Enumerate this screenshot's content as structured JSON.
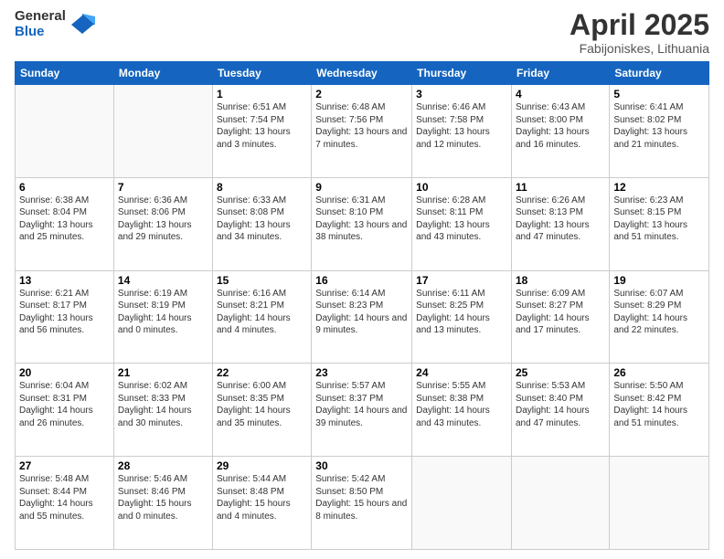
{
  "header": {
    "logo_general": "General",
    "logo_blue": "Blue",
    "title": "April 2025",
    "location": "Fabijoniskes, Lithuania"
  },
  "weekdays": [
    "Sunday",
    "Monday",
    "Tuesday",
    "Wednesday",
    "Thursday",
    "Friday",
    "Saturday"
  ],
  "weeks": [
    [
      {
        "day": "",
        "info": ""
      },
      {
        "day": "",
        "info": ""
      },
      {
        "day": "1",
        "info": "Sunrise: 6:51 AM\nSunset: 7:54 PM\nDaylight: 13 hours and 3 minutes."
      },
      {
        "day": "2",
        "info": "Sunrise: 6:48 AM\nSunset: 7:56 PM\nDaylight: 13 hours and 7 minutes."
      },
      {
        "day": "3",
        "info": "Sunrise: 6:46 AM\nSunset: 7:58 PM\nDaylight: 13 hours and 12 minutes."
      },
      {
        "day": "4",
        "info": "Sunrise: 6:43 AM\nSunset: 8:00 PM\nDaylight: 13 hours and 16 minutes."
      },
      {
        "day": "5",
        "info": "Sunrise: 6:41 AM\nSunset: 8:02 PM\nDaylight: 13 hours and 21 minutes."
      }
    ],
    [
      {
        "day": "6",
        "info": "Sunrise: 6:38 AM\nSunset: 8:04 PM\nDaylight: 13 hours and 25 minutes."
      },
      {
        "day": "7",
        "info": "Sunrise: 6:36 AM\nSunset: 8:06 PM\nDaylight: 13 hours and 29 minutes."
      },
      {
        "day": "8",
        "info": "Sunrise: 6:33 AM\nSunset: 8:08 PM\nDaylight: 13 hours and 34 minutes."
      },
      {
        "day": "9",
        "info": "Sunrise: 6:31 AM\nSunset: 8:10 PM\nDaylight: 13 hours and 38 minutes."
      },
      {
        "day": "10",
        "info": "Sunrise: 6:28 AM\nSunset: 8:11 PM\nDaylight: 13 hours and 43 minutes."
      },
      {
        "day": "11",
        "info": "Sunrise: 6:26 AM\nSunset: 8:13 PM\nDaylight: 13 hours and 47 minutes."
      },
      {
        "day": "12",
        "info": "Sunrise: 6:23 AM\nSunset: 8:15 PM\nDaylight: 13 hours and 51 minutes."
      }
    ],
    [
      {
        "day": "13",
        "info": "Sunrise: 6:21 AM\nSunset: 8:17 PM\nDaylight: 13 hours and 56 minutes."
      },
      {
        "day": "14",
        "info": "Sunrise: 6:19 AM\nSunset: 8:19 PM\nDaylight: 14 hours and 0 minutes."
      },
      {
        "day": "15",
        "info": "Sunrise: 6:16 AM\nSunset: 8:21 PM\nDaylight: 14 hours and 4 minutes."
      },
      {
        "day": "16",
        "info": "Sunrise: 6:14 AM\nSunset: 8:23 PM\nDaylight: 14 hours and 9 minutes."
      },
      {
        "day": "17",
        "info": "Sunrise: 6:11 AM\nSunset: 8:25 PM\nDaylight: 14 hours and 13 minutes."
      },
      {
        "day": "18",
        "info": "Sunrise: 6:09 AM\nSunset: 8:27 PM\nDaylight: 14 hours and 17 minutes."
      },
      {
        "day": "19",
        "info": "Sunrise: 6:07 AM\nSunset: 8:29 PM\nDaylight: 14 hours and 22 minutes."
      }
    ],
    [
      {
        "day": "20",
        "info": "Sunrise: 6:04 AM\nSunset: 8:31 PM\nDaylight: 14 hours and 26 minutes."
      },
      {
        "day": "21",
        "info": "Sunrise: 6:02 AM\nSunset: 8:33 PM\nDaylight: 14 hours and 30 minutes."
      },
      {
        "day": "22",
        "info": "Sunrise: 6:00 AM\nSunset: 8:35 PM\nDaylight: 14 hours and 35 minutes."
      },
      {
        "day": "23",
        "info": "Sunrise: 5:57 AM\nSunset: 8:37 PM\nDaylight: 14 hours and 39 minutes."
      },
      {
        "day": "24",
        "info": "Sunrise: 5:55 AM\nSunset: 8:38 PM\nDaylight: 14 hours and 43 minutes."
      },
      {
        "day": "25",
        "info": "Sunrise: 5:53 AM\nSunset: 8:40 PM\nDaylight: 14 hours and 47 minutes."
      },
      {
        "day": "26",
        "info": "Sunrise: 5:50 AM\nSunset: 8:42 PM\nDaylight: 14 hours and 51 minutes."
      }
    ],
    [
      {
        "day": "27",
        "info": "Sunrise: 5:48 AM\nSunset: 8:44 PM\nDaylight: 14 hours and 55 minutes."
      },
      {
        "day": "28",
        "info": "Sunrise: 5:46 AM\nSunset: 8:46 PM\nDaylight: 15 hours and 0 minutes."
      },
      {
        "day": "29",
        "info": "Sunrise: 5:44 AM\nSunset: 8:48 PM\nDaylight: 15 hours and 4 minutes."
      },
      {
        "day": "30",
        "info": "Sunrise: 5:42 AM\nSunset: 8:50 PM\nDaylight: 15 hours and 8 minutes."
      },
      {
        "day": "",
        "info": ""
      },
      {
        "day": "",
        "info": ""
      },
      {
        "day": "",
        "info": ""
      }
    ]
  ]
}
